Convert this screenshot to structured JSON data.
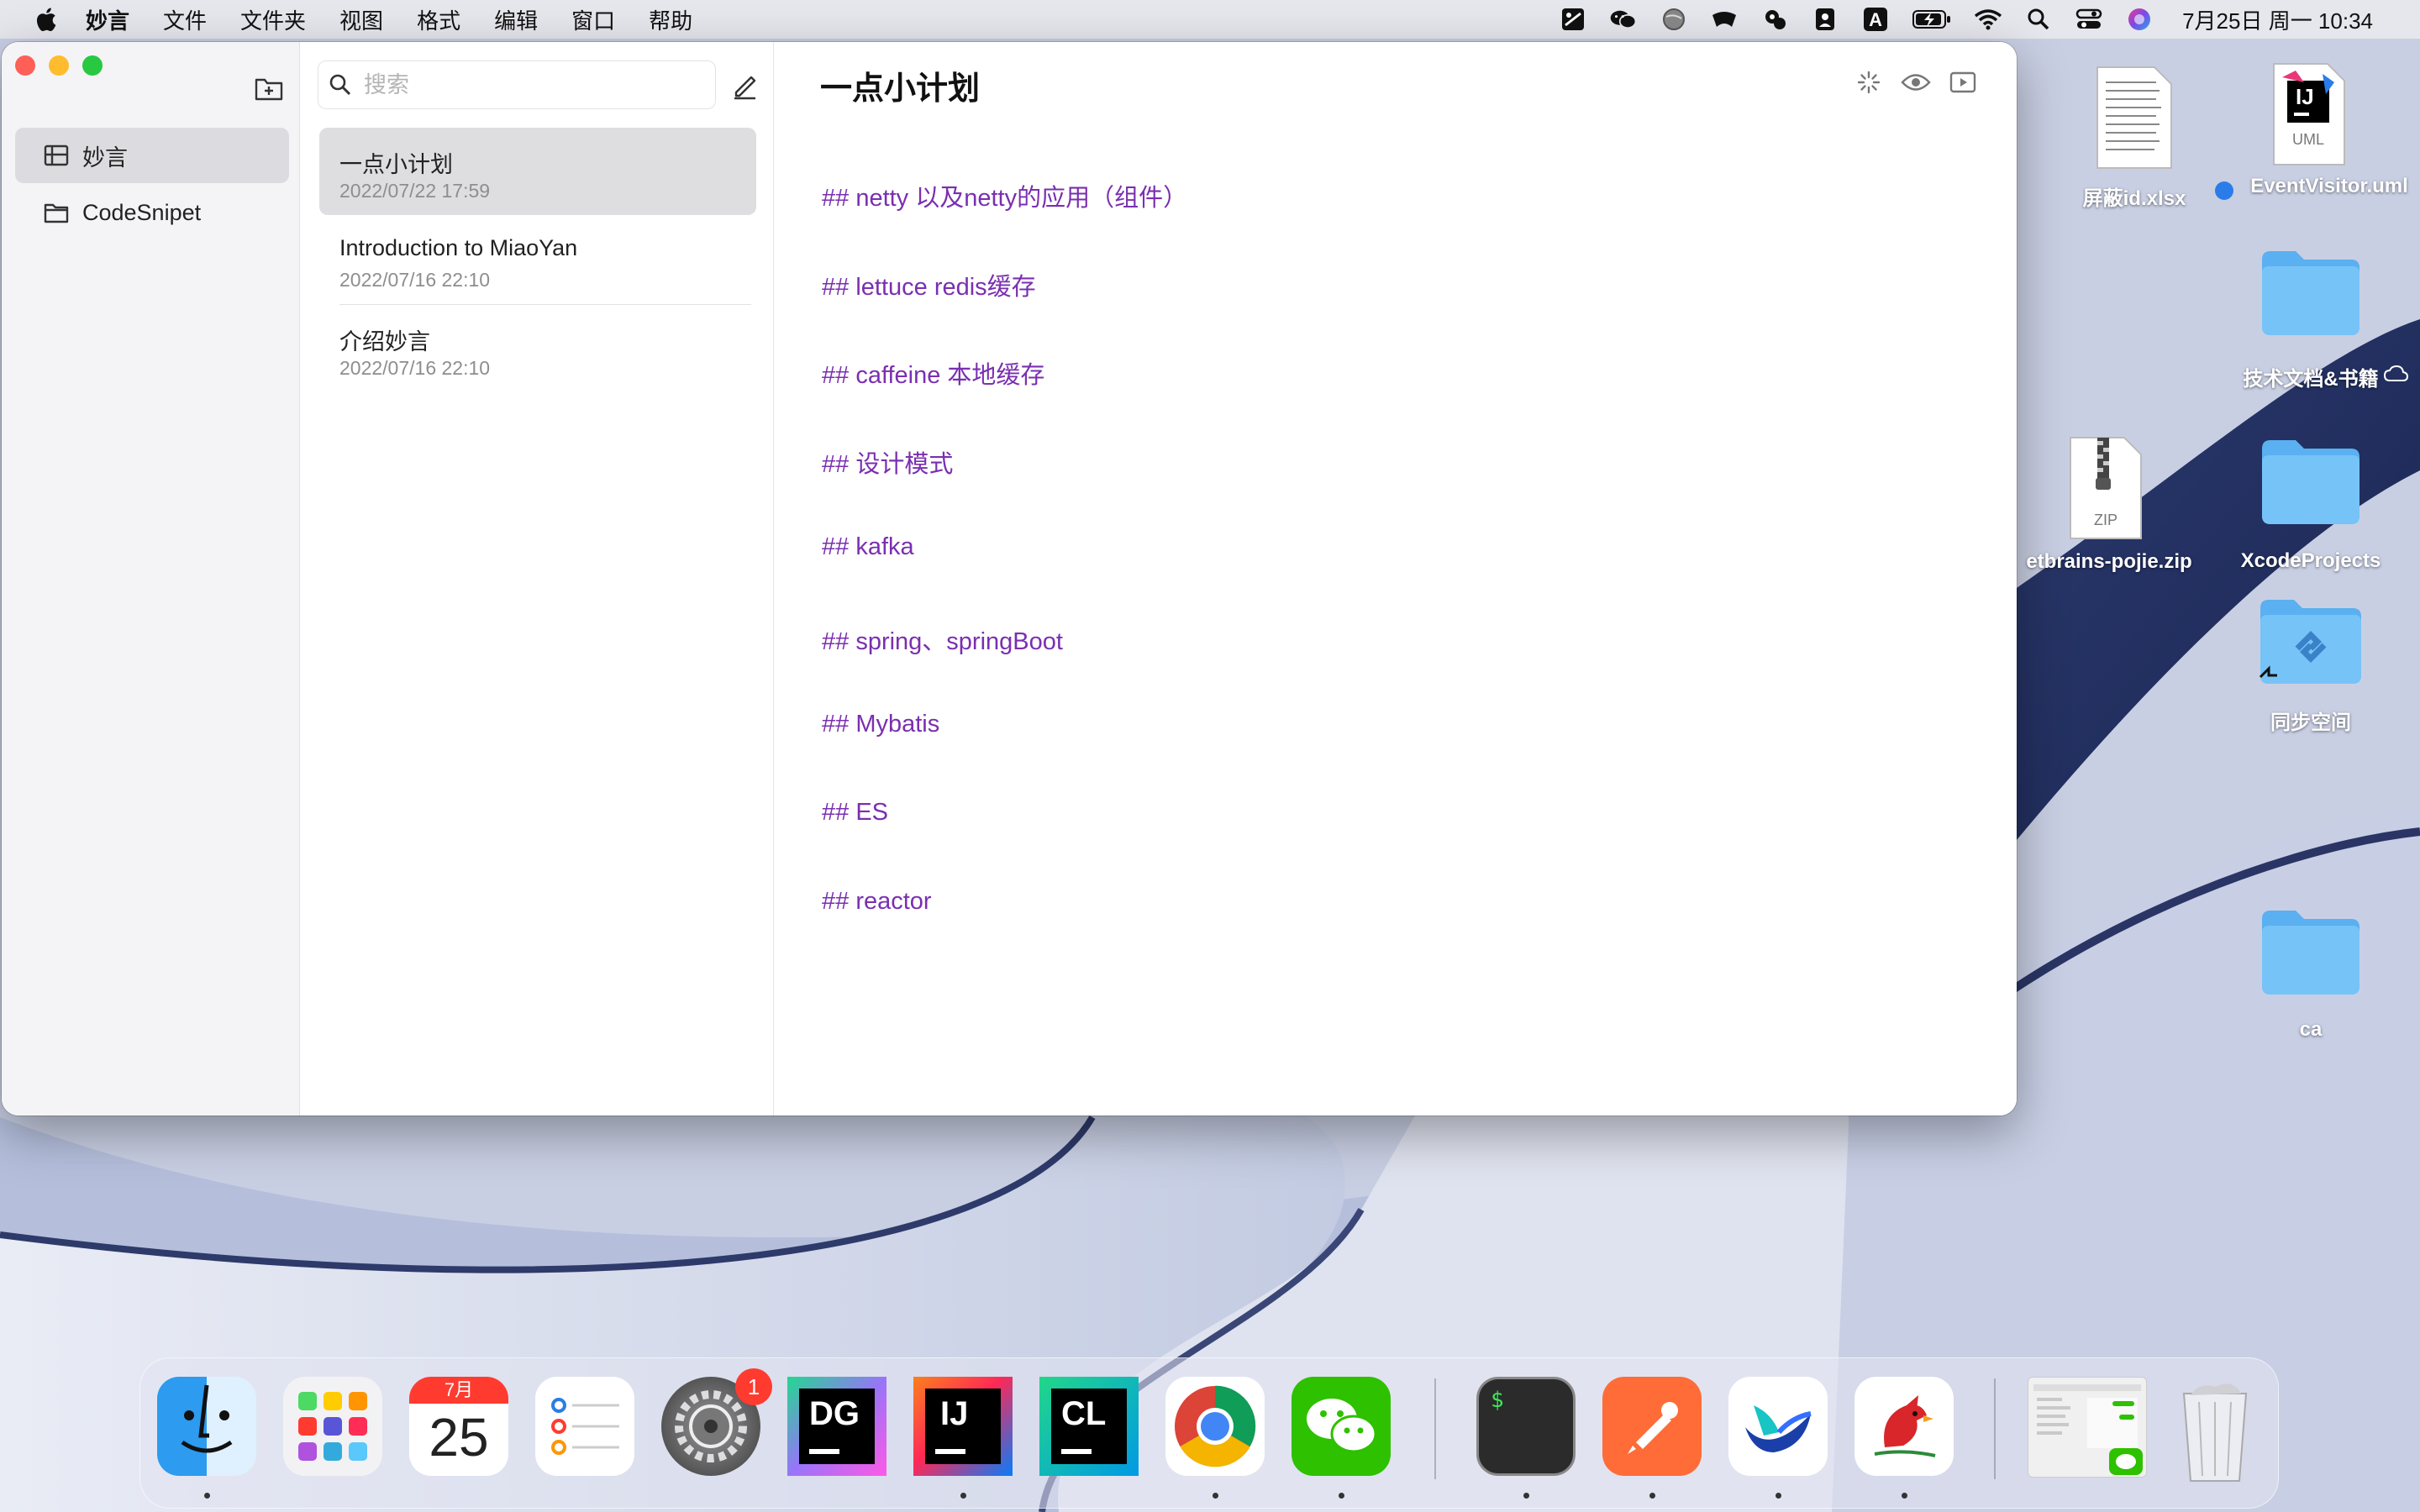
{
  "menubar": {
    "app_name": "妙言",
    "menus": [
      "文件",
      "文件夹",
      "视图",
      "格式",
      "编辑",
      "窗口",
      "帮助"
    ],
    "clock": "7月25日 周一  10:34",
    "status_icons": [
      "scratch-icon",
      "wechat-icon",
      "globe-icon",
      "bird-icon",
      "qq-icon",
      "contacts-icon",
      "input-method-icon",
      "battery-icon",
      "wifi-icon",
      "search-icon",
      "control-center-icon",
      "siri-icon"
    ],
    "input_method_label": "A"
  },
  "sidebar": {
    "folders": [
      {
        "label": "妙言",
        "selected": true
      },
      {
        "label": "CodeSnipet",
        "selected": false
      }
    ]
  },
  "notelist": {
    "search_placeholder": "搜索",
    "notes": [
      {
        "title": "一点小计划",
        "date": "2022/07/22 17:59",
        "selected": true
      },
      {
        "title": "Introduction to MiaoYan",
        "date": "2022/07/16 22:10",
        "selected": false
      },
      {
        "title": "介绍妙言",
        "date": "2022/07/16 22:10",
        "selected": false
      }
    ]
  },
  "editor": {
    "title": "一点小计划",
    "lines": [
      "## netty 以及netty的应用（组件）",
      "## lettuce redis缓存",
      "## caffeine 本地缓存",
      "## 设计模式",
      "## kafka",
      "## spring、springBoot",
      "## Mybatis",
      "## ES",
      "## reactor"
    ],
    "heading_color": "#7a2fb0"
  },
  "desktop": {
    "icons": [
      {
        "label": "屏蔽id.xlsx",
        "kind": "spreadsheet-file-icon"
      },
      {
        "label": "EventVisitor.uml",
        "kind": "uml-file-icon",
        "badge_text": "UML",
        "logo_text": "IJ"
      },
      {
        "label": "技术文档&书籍",
        "kind": "folder-icon"
      },
      {
        "label": "etbrains-pojie.zip",
        "kind": "zip-file-icon",
        "badge_text": "ZIP"
      },
      {
        "label": "XcodeProjects",
        "kind": "folder-icon"
      },
      {
        "label": "同步空间",
        "kind": "sync-folder-icon"
      },
      {
        "label": "ca",
        "kind": "folder-icon"
      }
    ]
  },
  "dock": {
    "apps": [
      {
        "name": "finder-icon",
        "running": true
      },
      {
        "name": "launchpad-icon",
        "running": false
      },
      {
        "name": "calendar-icon",
        "running": false,
        "month": "7月",
        "day": "25"
      },
      {
        "name": "reminders-icon",
        "running": false
      },
      {
        "name": "system-preferences-icon",
        "running": false,
        "badge": "1"
      },
      {
        "name": "datagrip-icon",
        "running": false,
        "text": "DG"
      },
      {
        "name": "intellij-icon",
        "running": true,
        "text": "IJ"
      },
      {
        "name": "clion-icon",
        "running": false,
        "text": "CL"
      },
      {
        "name": "chrome-icon",
        "running": true
      },
      {
        "name": "wechat-icon",
        "running": true
      },
      {
        "name": "terminal-icon",
        "running": true,
        "text": "$"
      },
      {
        "name": "postman-icon",
        "running": true
      },
      {
        "name": "feishu-icon",
        "running": true
      },
      {
        "name": "cardinal-icon",
        "running": true
      },
      {
        "name": "recent-window-icon",
        "running": false
      },
      {
        "name": "trash-icon",
        "running": false
      }
    ]
  }
}
